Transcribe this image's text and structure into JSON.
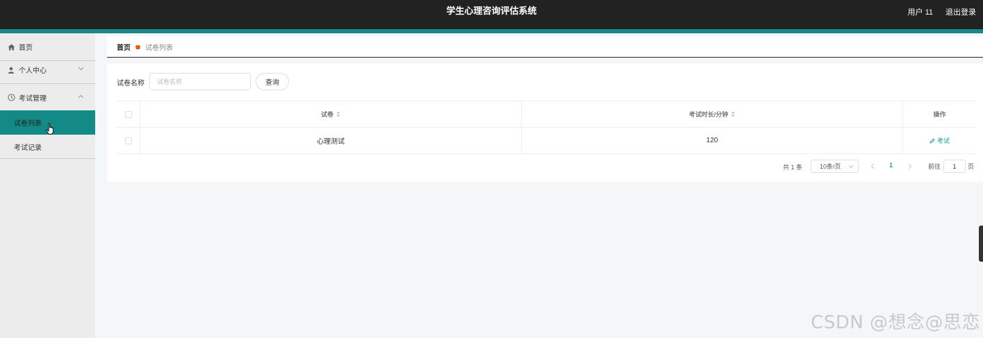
{
  "header": {
    "title": "学生心理咨询评估系统",
    "user": "用户 11",
    "logout": "退出登录"
  },
  "sidebar": {
    "items": [
      {
        "label": "首页",
        "icon": "home-icon"
      },
      {
        "label": "个人中心",
        "icon": "user-icon"
      },
      {
        "label": "考试管理",
        "icon": "clock-icon"
      },
      {
        "label": "试卷列表",
        "active": true
      },
      {
        "label": "考试记录"
      }
    ]
  },
  "breadcrumb": {
    "home": "首页",
    "current": "试卷列表"
  },
  "search": {
    "label": "试卷名称",
    "placeholder": "试卷名称",
    "button": "查询"
  },
  "table": {
    "columns": [
      "试卷",
      "考试时长/分钟",
      "操作"
    ],
    "rows": [
      {
        "name": "心理测试",
        "duration": "120",
        "action": "考试"
      }
    ]
  },
  "pagination": {
    "total": "共 1 条",
    "page_size": "10条/页",
    "current_page": "1",
    "goto_label": "前往",
    "goto_value": "1",
    "goto_unit": "页"
  },
  "watermark": "CSDN @想念@思恋",
  "colors": {
    "topbar": "#222222",
    "accent": "#178a87",
    "active_menu": "#148a87",
    "link": "#14a09c"
  }
}
